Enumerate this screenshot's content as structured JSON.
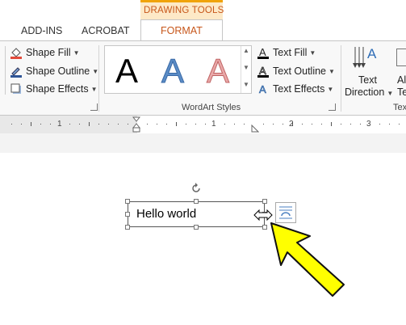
{
  "tabs": {
    "addins": "ADD-INS",
    "acrobat": "ACROBAT",
    "context_header": "DRAWING TOOLS",
    "format": "FORMAT"
  },
  "shape_styles": {
    "fill": "Shape Fill",
    "outline": "Shape Outline",
    "effects": "Shape Effects"
  },
  "wordart": {
    "letter": "A",
    "group_label": "WordArt Styles",
    "text_fill": "Text Fill",
    "text_outline": "Text Outline",
    "text_effects": "Text Effects"
  },
  "text_group": {
    "direction_line1": "Text",
    "direction_line2": "Direction",
    "clip_line1": "Al",
    "clip_line2": "Te",
    "group_label_clip": "Tex"
  },
  "ruler": {
    "marks": [
      "1",
      "1",
      "2",
      "3"
    ]
  },
  "document": {
    "textbox_text": "Hello world"
  },
  "colors": {
    "accent": "#c7571b",
    "arrow": "#ffff00",
    "wordart_blue": "#5b8cc6",
    "wordart_red": "#e9a8a8"
  }
}
